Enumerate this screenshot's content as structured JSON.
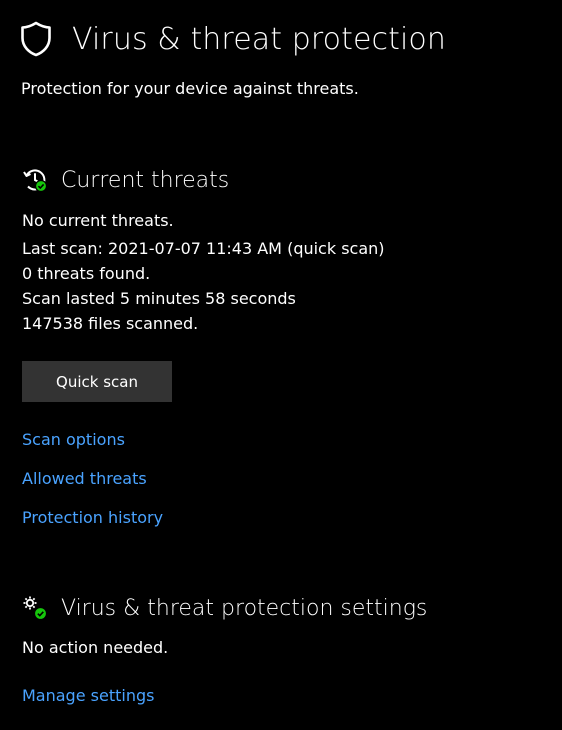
{
  "theme": {
    "background": "#000000",
    "text": "#ffffff",
    "link": "#4aa3ff",
    "button_bg": "#333333",
    "status_ok": "#16c60c"
  },
  "header": {
    "title": "Virus & threat protection",
    "subtitle": "Protection for your device against threats.",
    "icon": "shield-icon"
  },
  "current_threats": {
    "title": "Current threats",
    "icon": "history-check-icon",
    "status": "No current threats.",
    "last_scan": "Last scan: 2021-07-07 11:43 AM (quick scan)",
    "threats_found": "0 threats found.",
    "duration": "Scan lasted 5 minutes 58 seconds",
    "files_scanned": "147538 files scanned.",
    "quick_scan_label": "Quick scan",
    "links": {
      "scan_options": "Scan options",
      "allowed_threats": "Allowed threats",
      "protection_history": "Protection history"
    }
  },
  "settings": {
    "title": "Virus & threat protection settings",
    "icon": "gears-check-icon",
    "status": "No action needed.",
    "manage_link": "Manage settings"
  }
}
